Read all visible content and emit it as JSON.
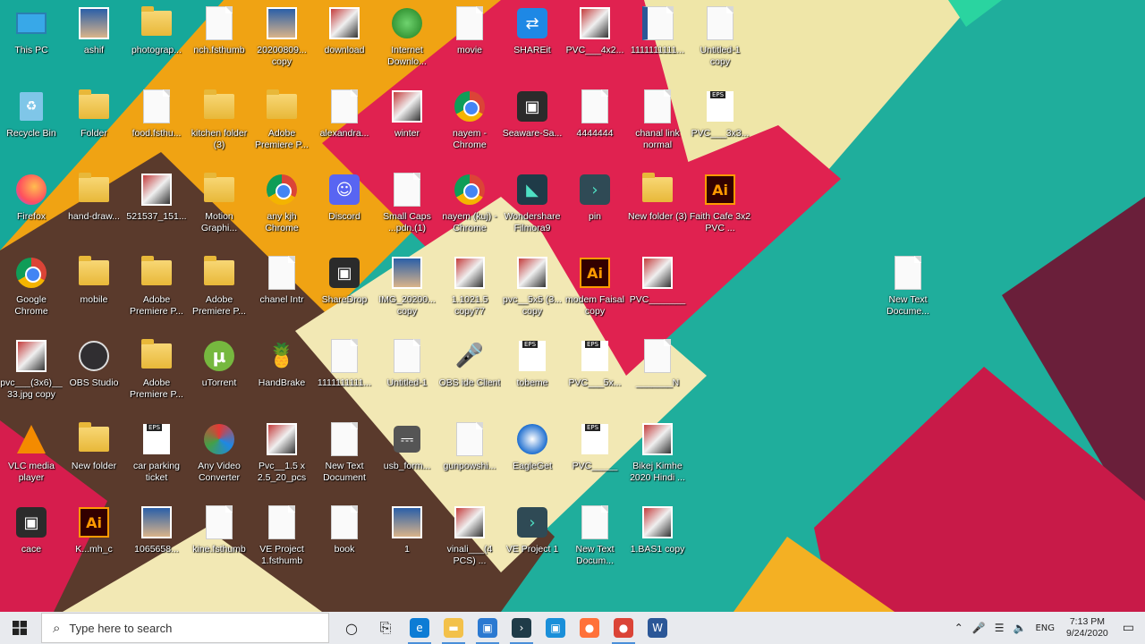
{
  "desktop": {
    "icons": [
      {
        "label": "This PC",
        "icon": "pc-icon"
      },
      {
        "label": "Recycle Bin",
        "icon": "recycle-bin-icon"
      },
      {
        "label": "Firefox",
        "icon": "firefox-icon"
      },
      {
        "label": "Google Chrome",
        "icon": "chrome-icon"
      },
      {
        "label": "pvc___(3x6)__33.jpg copy",
        "icon": "image-file-icon"
      },
      {
        "label": "VLC media player",
        "icon": "vlc-icon"
      },
      {
        "label": "cace",
        "icon": "app-shortcut-icon"
      },
      {
        "label": "ashif",
        "icon": "photo-icon"
      },
      {
        "label": "Folder",
        "icon": "folder-icon"
      },
      {
        "label": "hand-draw...",
        "icon": "folder-icon"
      },
      {
        "label": "mobile",
        "icon": "folder-icon"
      },
      {
        "label": "OBS Studio",
        "icon": "obs-icon"
      },
      {
        "label": "New folder",
        "icon": "folder-icon"
      },
      {
        "label": "K...mh_c",
        "icon": "illustrator-file-icon"
      },
      {
        "label": "photograp...",
        "icon": "folder-icon"
      },
      {
        "label": "food.fsthu...",
        "icon": "document-icon"
      },
      {
        "label": "521537_151...",
        "icon": "image-file-icon"
      },
      {
        "label": "Adobe Premiere P...",
        "icon": "folder-icon"
      },
      {
        "label": "Adobe Premiere P...",
        "icon": "folder-icon"
      },
      {
        "label": "car parking ticket",
        "icon": "eps-file-icon"
      },
      {
        "label": "1065658...",
        "icon": "photo-icon"
      },
      {
        "label": "nch.fsthumb",
        "icon": "document-icon"
      },
      {
        "label": "kitchen folder (3)",
        "icon": "folder-icon"
      },
      {
        "label": "Motion Graphi...",
        "icon": "folder-icon"
      },
      {
        "label": "Adobe Premiere P...",
        "icon": "folder-icon"
      },
      {
        "label": "uTorrent",
        "icon": "utorrent-icon"
      },
      {
        "label": "Any Video Converter",
        "icon": "any-video-converter-icon"
      },
      {
        "label": "kine.fsthumb",
        "icon": "document-icon"
      },
      {
        "label": "20200809... copy",
        "icon": "photo-icon"
      },
      {
        "label": "Adobe Premiere P...",
        "icon": "folder-icon"
      },
      {
        "label": "any kjh Chrome",
        "icon": "chrome-icon"
      },
      {
        "label": "chanel Intr",
        "icon": "document-icon"
      },
      {
        "label": "HandBrake",
        "icon": "handbrake-icon"
      },
      {
        "label": "Pvc__1.5 x 2.5_20_pcs",
        "icon": "image-file-icon"
      },
      {
        "label": "VE Project 1.fsthumb",
        "icon": "document-icon"
      },
      {
        "label": "download",
        "icon": "image-file-icon"
      },
      {
        "label": "alexandra...",
        "icon": "document-icon"
      },
      {
        "label": "Discord",
        "icon": "discord-icon"
      },
      {
        "label": "ShareDrop",
        "icon": "app-shortcut-icon"
      },
      {
        "label": "1111111111...",
        "icon": "document-icon"
      },
      {
        "label": "New Text Document",
        "icon": "document-icon"
      },
      {
        "label": "book",
        "icon": "document-icon"
      },
      {
        "label": "Internet Downlo...",
        "icon": "idm-icon"
      },
      {
        "label": "winter",
        "icon": "image-file-icon"
      },
      {
        "label": "Small Caps ...pdn.(1)",
        "icon": "document-icon"
      },
      {
        "label": "IMG_20200... copy",
        "icon": "photo-icon"
      },
      {
        "label": "Untitled-1",
        "icon": "document-icon"
      },
      {
        "label": "usb_form...",
        "icon": "usb-icon"
      },
      {
        "label": "1",
        "icon": "photo-icon"
      },
      {
        "label": "movie",
        "icon": "document-icon"
      },
      {
        "label": "nayem - Chrome",
        "icon": "chrome-icon"
      },
      {
        "label": "nayem (kuj) - Chrome",
        "icon": "chrome-icon"
      },
      {
        "label": "1.1021.5 copy77",
        "icon": "image-file-icon"
      },
      {
        "label": "OBS ide Client",
        "icon": "microphone-icon"
      },
      {
        "label": "gunpowshi...",
        "icon": "document-icon"
      },
      {
        "label": "vinali___(4 PCS) ...",
        "icon": "image-file-icon"
      },
      {
        "label": "SHAREit",
        "icon": "shareit-icon"
      },
      {
        "label": "Seaware-Sa...",
        "icon": "app-shortcut-icon"
      },
      {
        "label": "Wondershare Filmora9",
        "icon": "filmora-icon"
      },
      {
        "label": "pvc__5x5 (3... copy",
        "icon": "image-file-icon"
      },
      {
        "label": "tobeme",
        "icon": "eps-file-icon"
      },
      {
        "label": "EagleGet",
        "icon": "eagleget-icon"
      },
      {
        "label": "VE Project 1",
        "icon": "filmora-project-icon"
      },
      {
        "label": "PVC___4x2...",
        "icon": "image-file-icon"
      },
      {
        "label": "4444444",
        "icon": "document-icon"
      },
      {
        "label": "pin",
        "icon": "filmora-project-icon"
      },
      {
        "label": "modem Faisal copy",
        "icon": "illustrator-file-icon"
      },
      {
        "label": "PVC___5x...",
        "icon": "eps-file-icon"
      },
      {
        "label": "PVC_____",
        "icon": "eps-file-icon"
      },
      {
        "label": "New Text Docum...",
        "icon": "document-icon"
      },
      {
        "label": "1111111111...",
        "icon": "word-file-icon"
      },
      {
        "label": "chanal link normal",
        "icon": "document-icon"
      },
      {
        "label": "New folder (3)",
        "icon": "folder-icon"
      },
      {
        "label": "PVC_______",
        "icon": "image-file-icon"
      },
      {
        "label": "_______N",
        "icon": "document-icon"
      },
      {
        "label": "Bikej Kimhe 2020 Hindi ...",
        "icon": "image-file-icon"
      },
      {
        "label": "1.BAS1 copy",
        "icon": "image-file-icon"
      },
      {
        "label": "Untitled-1 copy",
        "icon": "document-icon"
      },
      {
        "label": "PVC___3x3...",
        "icon": "eps-file-icon"
      },
      {
        "label": "Faith Cafe 3x2 PVC ...",
        "icon": "illustrator-file-icon"
      },
      {
        "label": "New Text Docume...",
        "icon": "document-icon"
      }
    ]
  },
  "taskbar": {
    "start_label": "Start",
    "search_placeholder": "Type here to search",
    "pinned": [
      {
        "name": "cortana",
        "icon": "cortana-icon",
        "color": "#222222"
      },
      {
        "name": "task-view",
        "icon": "task-view-icon",
        "color": "#222222"
      },
      {
        "name": "edge",
        "icon": "edge-icon",
        "color": "#0c7cd5"
      },
      {
        "name": "file-explorer",
        "icon": "file-explorer-icon",
        "color": "#f3c14a"
      },
      {
        "name": "sharex",
        "icon": "app-icon",
        "color": "#2b79d1"
      },
      {
        "name": "filmora",
        "icon": "filmora-icon",
        "color": "#1f3b48"
      },
      {
        "name": "settings-app",
        "icon": "app-icon",
        "color": "#1a8fd9"
      },
      {
        "name": "firefox",
        "icon": "firefox-icon",
        "color": "#ff7139"
      },
      {
        "name": "chrome",
        "icon": "chrome-icon",
        "color": "#db4437"
      },
      {
        "name": "word",
        "icon": "word-icon",
        "color": "#2b5797"
      }
    ],
    "tray": {
      "language": "ENG",
      "time": "7:13 PM",
      "date": "9/24/2020"
    }
  }
}
